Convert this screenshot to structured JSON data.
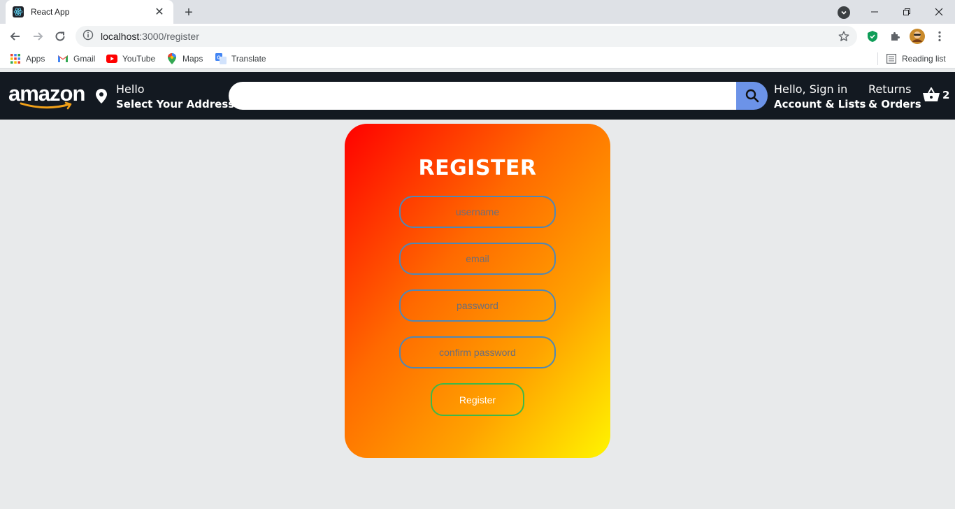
{
  "browser": {
    "tab_title": "React App",
    "tab_close": "✕",
    "new_tab": "+",
    "url_host": "localhost",
    "url_path": ":3000/register",
    "bookmarks": [
      {
        "label": "Apps",
        "icon": "apps-grid-icon"
      },
      {
        "label": "Gmail",
        "icon": "gmail-icon"
      },
      {
        "label": "YouTube",
        "icon": "youtube-icon"
      },
      {
        "label": "Maps",
        "icon": "maps-icon"
      },
      {
        "label": "Translate",
        "icon": "translate-icon"
      }
    ],
    "reading_list": "Reading list"
  },
  "header": {
    "logo": "amazon",
    "address_line1": "Hello",
    "address_line2": "Select Your Address",
    "search_placeholder": "",
    "account_line1": "Hello, Sign in",
    "account_line2": "Account & Lists",
    "returns_line1": "Returns",
    "returns_line2": "& Orders",
    "cart_count": "2",
    "colors": {
      "bar": "#131921",
      "search_button": "#6c93e8",
      "logo_smile": "#f0a019"
    }
  },
  "register": {
    "title": "REGISTER",
    "username_placeholder": "username",
    "email_placeholder": "email",
    "password_placeholder": "password",
    "confirm_placeholder": "confirm password",
    "button_label": "Register",
    "colors": {
      "gradient_start": "#ff0000",
      "gradient_end": "#fff500",
      "field_border": "#4f88b6",
      "button_border": "#3db84a"
    }
  }
}
